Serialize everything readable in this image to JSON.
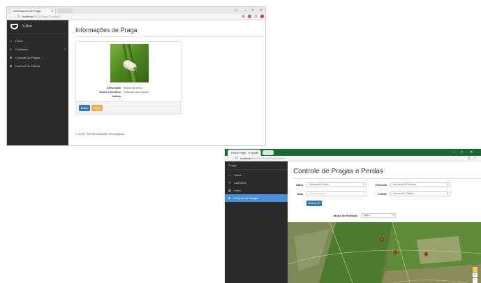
{
  "window1": {
    "tab_title": "Informações da Praga",
    "url_host": "localhost",
    "url_path": ":8181/Praga/Detalhe/7",
    "app_name": "S-Boo",
    "nav": [
      {
        "label": "Home",
        "icon": "home-icon"
      },
      {
        "label": "Cadastros",
        "icon": "pencil-icon",
        "has_submenu": true
      },
      {
        "label": "Controle De Pragas",
        "icon": "bug-icon"
      },
      {
        "label": "Controle De Plantas",
        "icon": "leaf-icon"
      }
    ],
    "page_title": "Informações de Praga",
    "details": [
      {
        "label": "Descrição",
        "value": "Broca da cana"
      },
      {
        "label": "Nome Científico",
        "value": "Diatraea saccharalis"
      },
      {
        "label": "Inativo",
        "value": "□"
      }
    ],
    "buttons": {
      "edit": "Editar",
      "back": "Voltar"
    },
    "footer": "© 2018 - SIRSB Soluções Tecnológicas"
  },
  "window2": {
    "tab_title": "Home Page - S-Agro",
    "url_host": "localhost",
    "url_path": ":8181/ControlePragas/Index",
    "app_name": "S-Agro",
    "nav": [
      {
        "label": "Home",
        "icon": "home-icon"
      },
      {
        "label": "Cadastros",
        "icon": "pencil-icon"
      },
      {
        "label": "Index",
        "icon": "grid-icon"
      },
      {
        "label": "Controle De Pragas",
        "icon": "bug-icon",
        "active": true
      }
    ],
    "page_title": "Controle de Pragas e Perdas",
    "form": {
      "safra_label": "Safra",
      "safra_value": "Selecione a Safra",
      "fazenda_label": "Fazenda",
      "fazenda_value": "Selecione a Fazenda",
      "data_label": "Data",
      "data_placeholder": "Data da Busca",
      "talhao_label": "Talhão",
      "talhao_value": "Selecione o Talhão",
      "buscar_label": "Buscar",
      "modo_label": "Modo de Exibição",
      "modo_value": "Mapa"
    },
    "map": {
      "zoom_in": "+",
      "zoom_out": "−"
    }
  },
  "colors": {
    "sidebar": "#2b2b2b",
    "accent_blue": "#337ab7",
    "active_nav": "#4a90d9",
    "back_button": "#f0ad4e",
    "chrome_green": "#1a6b2f"
  }
}
